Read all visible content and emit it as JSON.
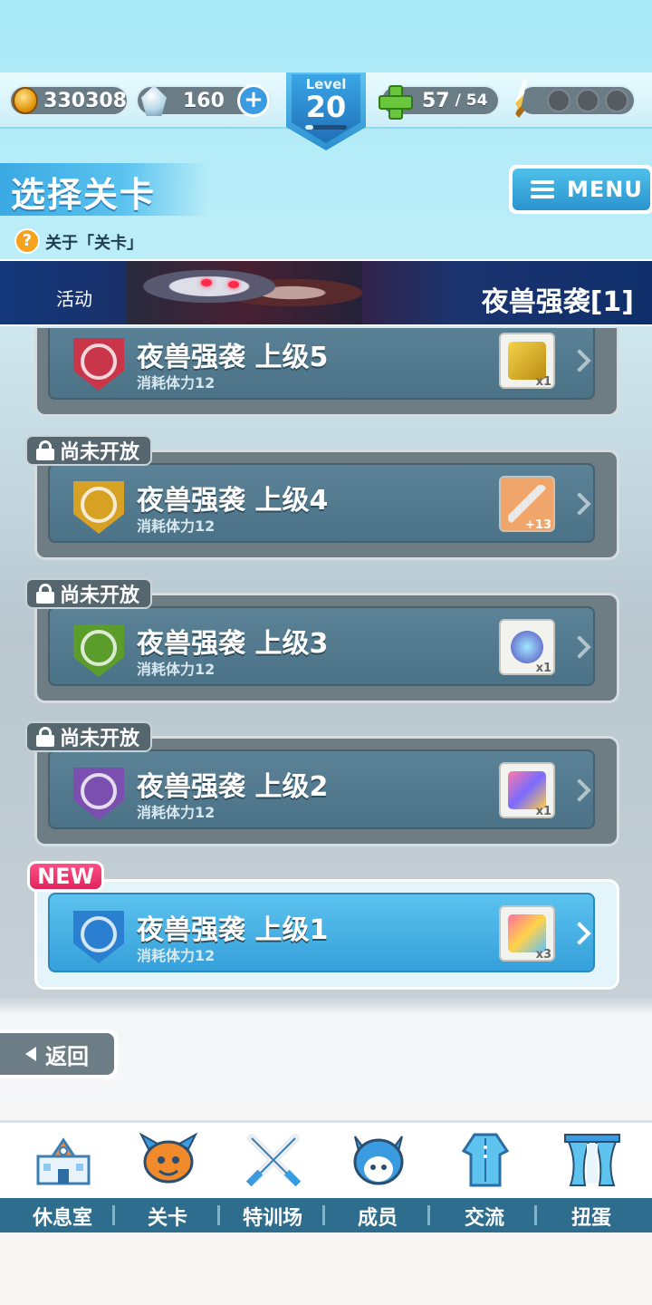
{
  "currency": {
    "coins": "330308",
    "gems": "160",
    "add_label": "+"
  },
  "level": {
    "label": "Level",
    "value": "20",
    "progress": 0.2
  },
  "stamina": {
    "current": "57",
    "max": "/ 54"
  },
  "header": {
    "title": "选择关卡",
    "help_label": "关于「关卡」",
    "help_icon": "?",
    "menu_label": "MENU"
  },
  "banner": {
    "tag": "活动",
    "title": "夜兽强袭[1]"
  },
  "stages": [
    {
      "name": "夜兽强袭  上级5",
      "cost": "消耗体力12",
      "qty": "x1",
      "locked": false,
      "new": false
    },
    {
      "name": "夜兽强袭  上级4",
      "cost": "消耗体力12",
      "qty": "+13",
      "locked": true,
      "lock_label": "尚未开放"
    },
    {
      "name": "夜兽强袭  上级3",
      "cost": "消耗体力12",
      "qty": "x1",
      "locked": true,
      "lock_label": "尚未开放"
    },
    {
      "name": "夜兽强袭  上级2",
      "cost": "消耗体力12",
      "qty": "x1",
      "locked": true,
      "lock_label": "尚未开放"
    },
    {
      "name": "夜兽强袭  上级1",
      "cost": "消耗体力12",
      "qty": "x3",
      "locked": false,
      "new": true,
      "new_label": "NEW"
    }
  ],
  "back": {
    "label": "返回"
  },
  "nav": [
    {
      "label": "休息室",
      "icon": "lounge-building-icon"
    },
    {
      "label": "关卡",
      "icon": "stage-monster-icon"
    },
    {
      "label": "特训场",
      "icon": "training-swords-icon"
    },
    {
      "label": "成员",
      "icon": "member-cat-icon"
    },
    {
      "label": "交流",
      "icon": "dress-icon"
    },
    {
      "label": "扭蛋",
      "icon": "gacha-curtain-icon"
    }
  ],
  "colors": {
    "accent": "#35a0da",
    "locked_card": "#6e7c84",
    "new_tag": "#e0245e",
    "nav_strip": "#2e6d8e"
  }
}
